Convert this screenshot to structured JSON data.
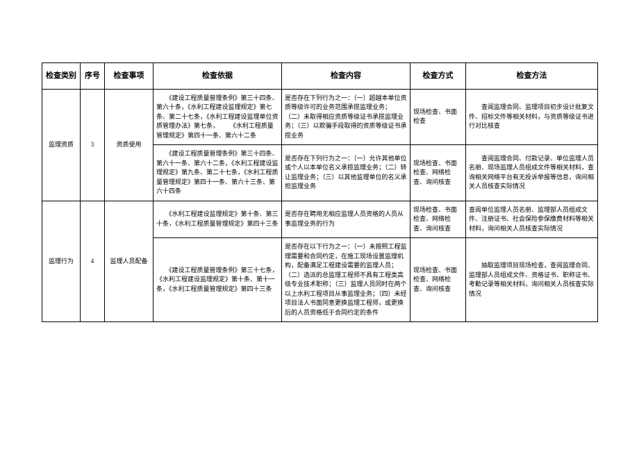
{
  "headers": {
    "category": "检查类别",
    "seq": "序号",
    "item": "检查事项",
    "basis": "检查依据",
    "content": "检查内容",
    "mode": "检查方式",
    "method": "检查方法"
  },
  "rows": [
    {
      "category": "监理资质",
      "seq": "3",
      "item": "资质使用",
      "basis": "　　《建设工程质量管理条例》第三十四条、第六十条，《水利工程建设监理规定》第七条、第二十七条，《水利工程建设监理单位资质管理办法》第七条，\n　　《水利工程质量管理规定》第四十一条、第六十二条",
      "content": "是否存在下列行为之一：（一）超越本单位资质等级许可的业务范围承揽监理业务；\n（二）未取得相应资质等级证书承揽监理业务；（三）以欺骗手段取得的资质等级证书承揽业务",
      "mode": "现场检查、书面检查",
      "method": "　　查阅监理合同、监理项目初步设计批复文件、招标文件等相关材料，与资质等级证书进行对比核查"
    },
    {
      "basis": "　　《建设工程质量管理条例》第三十四条、第六十一条、第六十二条，《水利工程建设监理规定》第九条、第二十七条，《水利工程质量管理规定》第四十一条、第六十三条、第六十四条",
      "content": "是否存在下列行为之一：（一）允许其他单位或个人以本单位名义承揽监理业务；（二）转让监理业务；（三）以其他监理单位的名义承担监理业务",
      "mode": "现场检查、书面检查、网络检查、询问核查",
      "method": "　　查阅监理合同、付款记录、单位监理人员名册、现场监理人员组成文件等相关材料，查询相关网络平台有无投诉举报等信息，询问相关人员核查实际情况"
    },
    {
      "category": "监理行为",
      "seq": "4",
      "item": "监理人员配备",
      "basis": "　　《水利工程建设监理规定》第十条、第三十条，《水利工程质量管理规定》第四十三条",
      "content": "是否存在聘用无相应监理人员资格的人员从事监理业务的行为",
      "mode": "现场检查、书面检查、网络检查、询问核查",
      "method": "查阅单位监理人员名册、监理部人员组成文件、注册证书、社会保险参保缴费材料等相关材料，询问相关人员核查实际情况"
    },
    {
      "basis": "　　《建设工程质量管理条例》第三十七条，《水利工程建设监理规定》第十条、第十一条，《水利工程质量管理规定》第四十三条",
      "content": "是否存在以下行为之一：（一）未按照工程监理需要和合同约定，在施工现场设置监理机构，配备满足工程建设需要的监理人员；\n（二）选派的总监理工程师不具有工程类高级专业技术职称；（三）监理人员同时在两个以上水利工程项目从事监理业务；（四）未经项目法人书面同意更换监理工程师，或更换后的人员资格低于合同约定的条件",
      "mode": "现场检查、书面检查、网络检查、询问核查",
      "method": "　　抽取监理项目现场检查，查阅监理合同、监理部人员组成文件、资格证书、职称证书、考勤记录等相关材料，询问相关人员核查实际情况"
    }
  ]
}
